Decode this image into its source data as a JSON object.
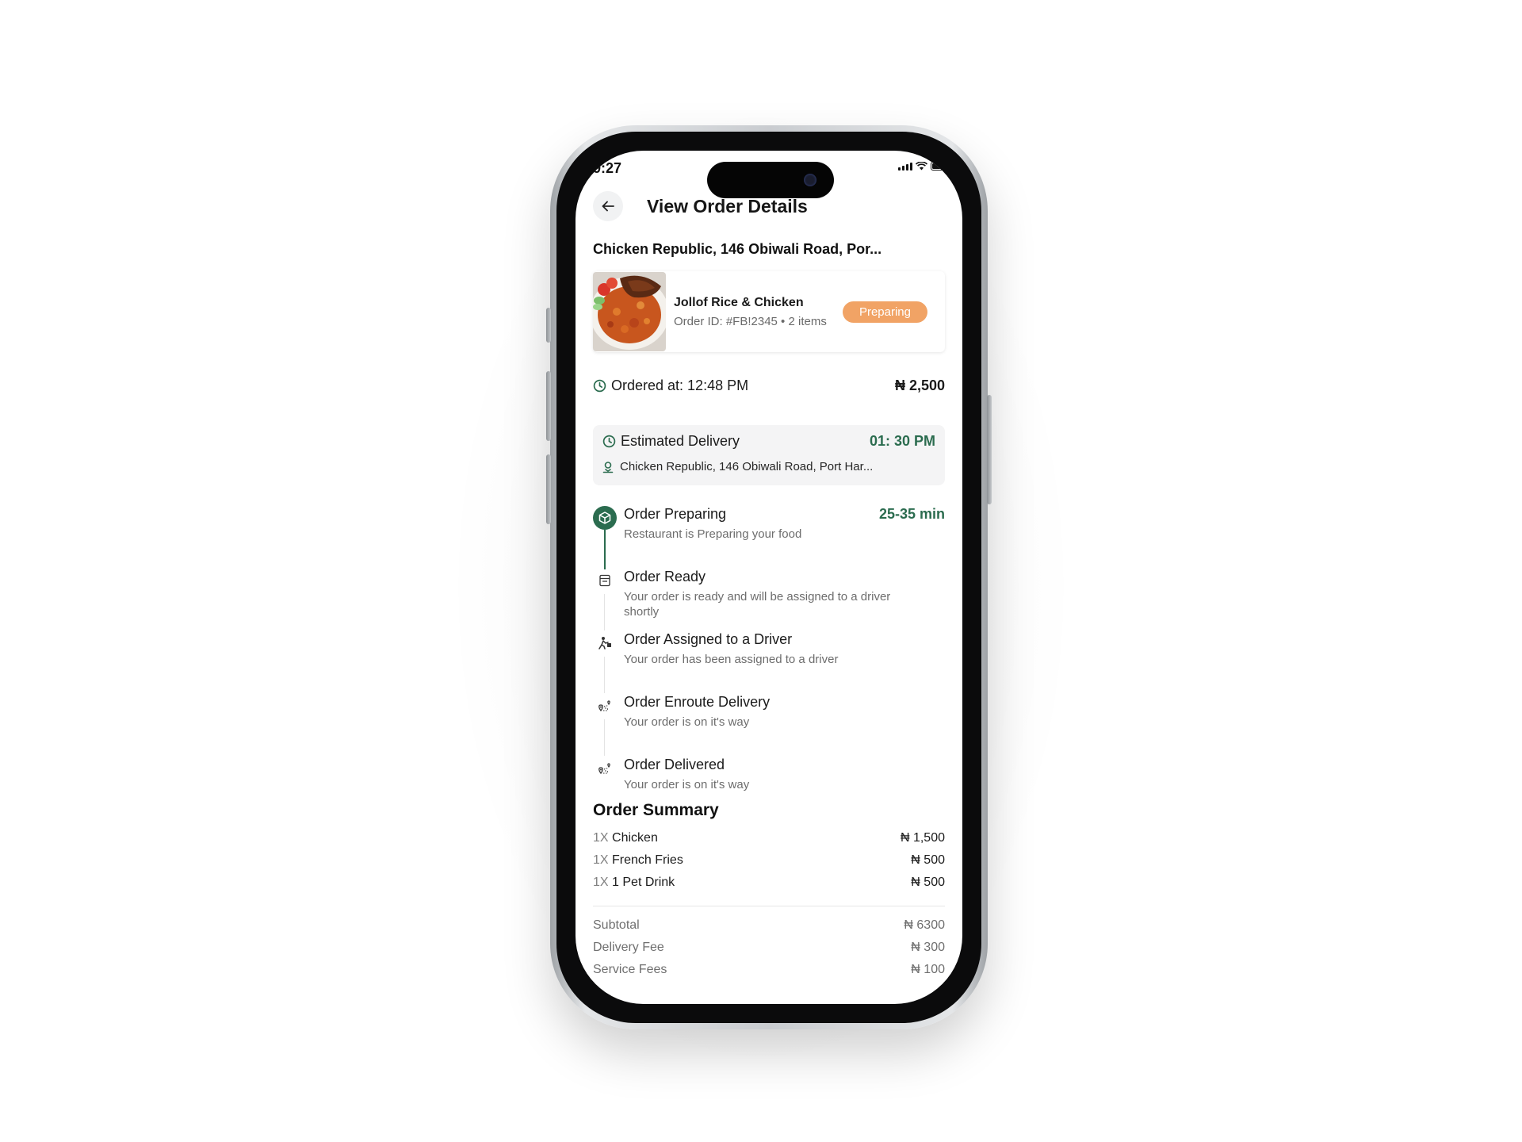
{
  "status_bar": {
    "time": "9:27"
  },
  "header": {
    "title": "View Order Details"
  },
  "restaurant": {
    "address": "Chicken Republic, 146 Obiwali Road, Por..."
  },
  "order_card": {
    "item_name": "Jollof Rice & Chicken",
    "meta": "Order ID: #FB!2345 • 2 items",
    "status": "Preparing",
    "status_color": "#f1a365"
  },
  "ordered": {
    "label": "Ordered at: 12:48 PM",
    "amount": "₦ 2,500"
  },
  "estimated": {
    "label": "Estimated Delivery",
    "time": "01: 30 PM",
    "address": "Chicken Republic, 146 Obiwali Road, Port Har..."
  },
  "timeline": [
    {
      "icon": "package-icon",
      "title": "Order Preparing",
      "desc": "Restaurant is Preparing your food",
      "eta": "25-35 min",
      "active": true
    },
    {
      "icon": "receipt-icon",
      "title": "Order Ready",
      "desc": "Your order is ready and will be assigned to a driver shortly",
      "active": false
    },
    {
      "icon": "driver-icon",
      "title": "Order Assigned to a Driver",
      "desc": "Your order has been assigned to a driver",
      "active": false
    },
    {
      "icon": "route-icon",
      "title": "Order Enroute Delivery",
      "desc": "Your order is on it's way",
      "active": false
    },
    {
      "icon": "route-icon",
      "title": "Order Delivered",
      "desc": "Your order is on it's way",
      "active": false
    }
  ],
  "summary": {
    "title": "Order Summary",
    "items": [
      {
        "qty": "1X",
        "name": "Chicken",
        "price": "₦ 1,500"
      },
      {
        "qty": "1X",
        "name": " French Fries",
        "price": "₦ 500"
      },
      {
        "qty": "1X",
        "name": " 1 Pet Drink",
        "price": "₦ 500"
      }
    ],
    "totals": [
      {
        "label": "Subtotal",
        "value": "₦ 6300"
      },
      {
        "label": "Delivery Fee",
        "value": "₦ 300"
      },
      {
        "label": "Service Fees",
        "value": "₦ 100"
      }
    ]
  },
  "colors": {
    "accent": "#2b6c4f",
    "pill": "#f1a365"
  }
}
